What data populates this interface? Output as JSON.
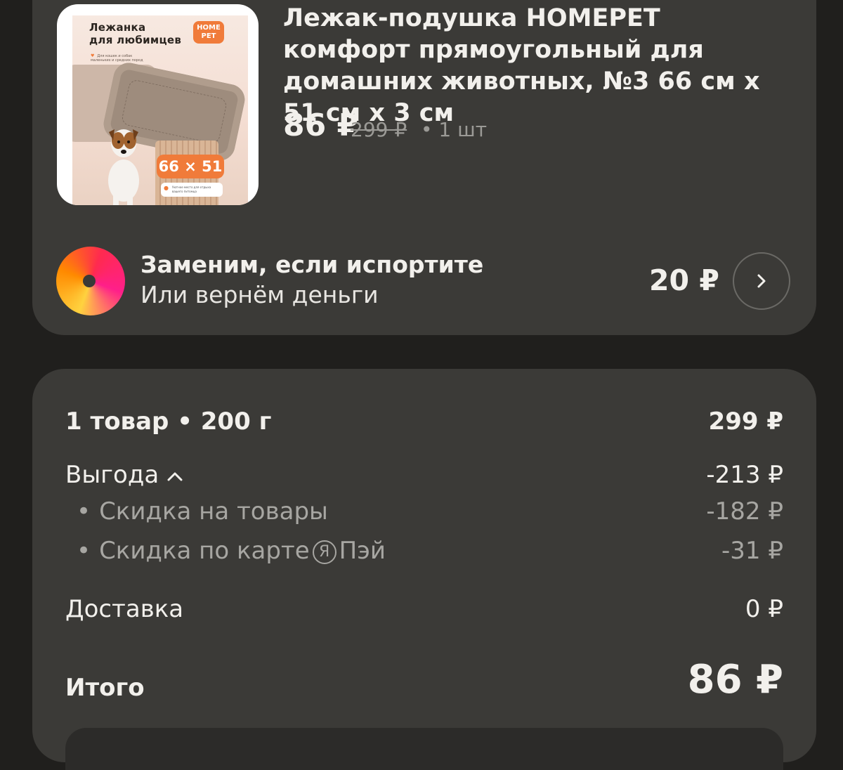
{
  "product": {
    "image_alt": "Лежанка для любимцев",
    "image_headline": "Лежанка\nдля любимцев",
    "image_brand": "HOME PET",
    "image_subtext": "Для кошек и собак маленьких и средних пород",
    "image_size_badge": "66 × 51 см",
    "image_note": "Уютное место для отдыха вашего питомца",
    "title": "Лежак-подушка HOMEPET комфорт прямоугольный для домашних животных, №3 66 см х 51 см х 3 см",
    "price_current": "86 ₽",
    "price_old": "299 ₽",
    "quantity": "• 1 шт"
  },
  "insurance": {
    "title": "Заменим, если испортите",
    "subtitle": "Или вернём деньги",
    "price": "20 ₽",
    "button_icon": "chevron-right-icon"
  },
  "summary": {
    "items_label": "1 товар • 200 г",
    "items_value": "299 ₽",
    "benefit_label": "Выгода",
    "benefit_value": "-213 ₽",
    "benefit_toggle_icon": "chevron-up-icon",
    "discount_goods_label": "Скидка на товары",
    "discount_goods_value": "-182 ₽",
    "discount_card_label_prefix": "Скидка по карте",
    "discount_card_badge": "Я",
    "discount_card_label_suffix": "Пэй",
    "discount_card_value": "-31 ₽",
    "delivery_label": "Доставка",
    "delivery_value": "0 ₽",
    "total_label": "Итого",
    "total_value": "86 ₽"
  },
  "colors": {
    "background": "#201f1d",
    "card": "#3b3a37",
    "text": "#f2f0ec",
    "muted": "#a7a6a2",
    "accent_orange": "#f07b3a"
  }
}
